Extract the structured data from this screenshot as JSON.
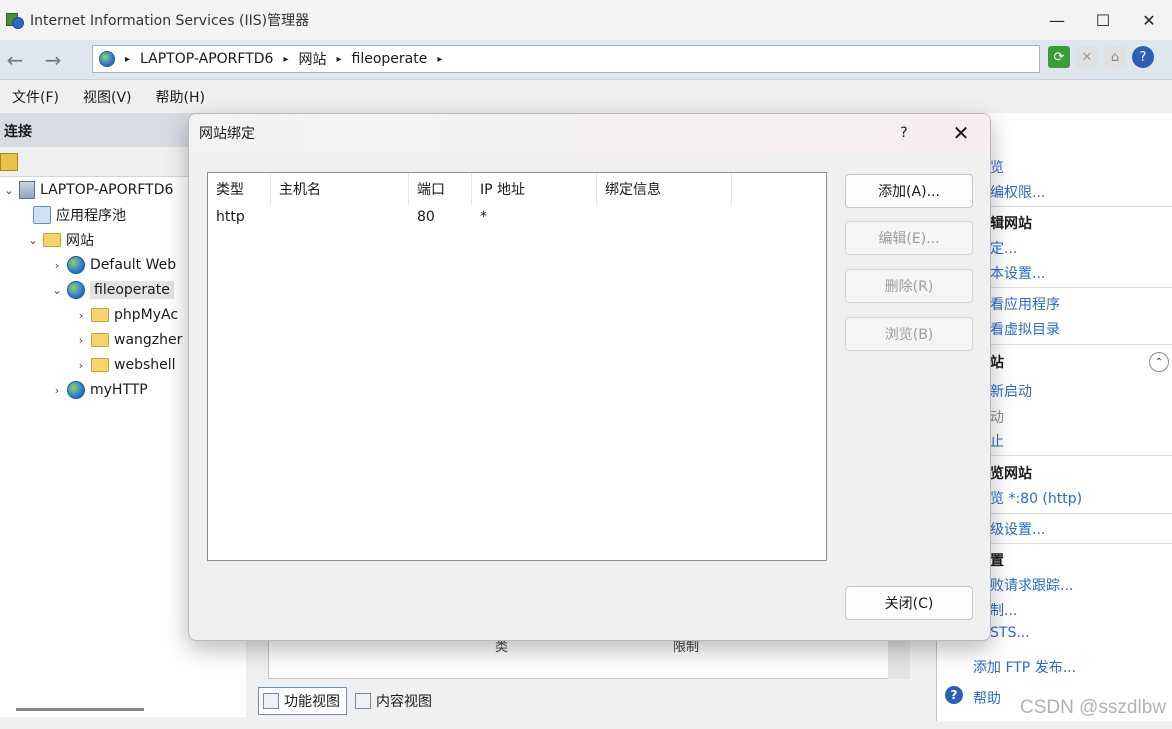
{
  "window": {
    "title": "Internet Information Services (IIS)管理器",
    "minimize": "—",
    "maximize": "☐",
    "close": "✕"
  },
  "nav": {
    "back": "←",
    "forward": "→",
    "breadcrumb": [
      "LAPTOP-APORFTD6",
      "网站",
      "fileoperate"
    ],
    "separator": "▸"
  },
  "menu": [
    "文件(F)",
    "视图(V)",
    "帮助(H)"
  ],
  "connections": {
    "header": "连接",
    "tree": [
      {
        "label": "LAPTOP-APORFTD6",
        "arrow": "v",
        "icon": "server-icon"
      },
      {
        "label": "应用程序池",
        "arrow": "",
        "icon": "app-pool-icon"
      },
      {
        "label": "网站",
        "arrow": "v",
        "icon": "folder-icon"
      },
      {
        "label": "Default Web",
        "arrow": ">",
        "icon": "globe-icon"
      },
      {
        "label": "fileoperate",
        "arrow": "v",
        "icon": "globe-icon"
      },
      {
        "label": "phpMyAc",
        "arrow": ">",
        "icon": "folder-icon"
      },
      {
        "label": "wangzher",
        "arrow": ">",
        "icon": "folder-icon"
      },
      {
        "label": "webshell",
        "arrow": ">",
        "icon": "folder-icon"
      },
      {
        "label": "myHTTP",
        "arrow": ">",
        "icon": "globe-icon"
      }
    ]
  },
  "actions": {
    "items": [
      {
        "text": "览",
        "kind": "link"
      },
      {
        "text": "编权限...",
        "kind": "link"
      },
      {
        "text": "辑网站",
        "kind": "head"
      },
      {
        "text": "定...",
        "kind": "link"
      },
      {
        "text": "本设置...",
        "kind": "link"
      },
      {
        "text": "看应用程序",
        "kind": "link"
      },
      {
        "text": "看虚拟目录",
        "kind": "link"
      },
      {
        "text": "站",
        "kind": "head"
      },
      {
        "text": "新启动",
        "kind": "link"
      },
      {
        "text": "动",
        "kind": "gray"
      },
      {
        "text": "止",
        "kind": "link"
      },
      {
        "text": "览网站",
        "kind": "head"
      },
      {
        "text": "览 *:80 (http)",
        "kind": "link"
      },
      {
        "text": "级设置...",
        "kind": "link"
      },
      {
        "text": "置",
        "kind": "head"
      },
      {
        "text": "败请求跟踪...",
        "kind": "link"
      },
      {
        "text": "制...",
        "kind": "link"
      },
      {
        "text": "STS...",
        "kind": "link"
      },
      {
        "text": "添加 FTP 发布...",
        "kind": "link"
      },
      {
        "text": "帮助",
        "kind": "link"
      }
    ],
    "collapse": "⌃",
    "help_icon": "?"
  },
  "center": {
    "ghost": [
      "类",
      "限制"
    ],
    "view_tabs": [
      "功能视图",
      "内容视图"
    ]
  },
  "dialog": {
    "title": "网站绑定",
    "help": "?",
    "close": "✕",
    "columns": [
      "类型",
      "主机名",
      "端口",
      "IP 地址",
      "绑定信息"
    ],
    "rows": [
      {
        "type": "http",
        "host": "",
        "port": "80",
        "ip": "*",
        "info": ""
      }
    ],
    "buttons": {
      "add": "添加(A)...",
      "edit": "编辑(E)...",
      "remove": "删除(R)",
      "browse": "浏览(B)",
      "close": "关闭(C)"
    }
  },
  "watermark": "CSDN @sszdlbw"
}
